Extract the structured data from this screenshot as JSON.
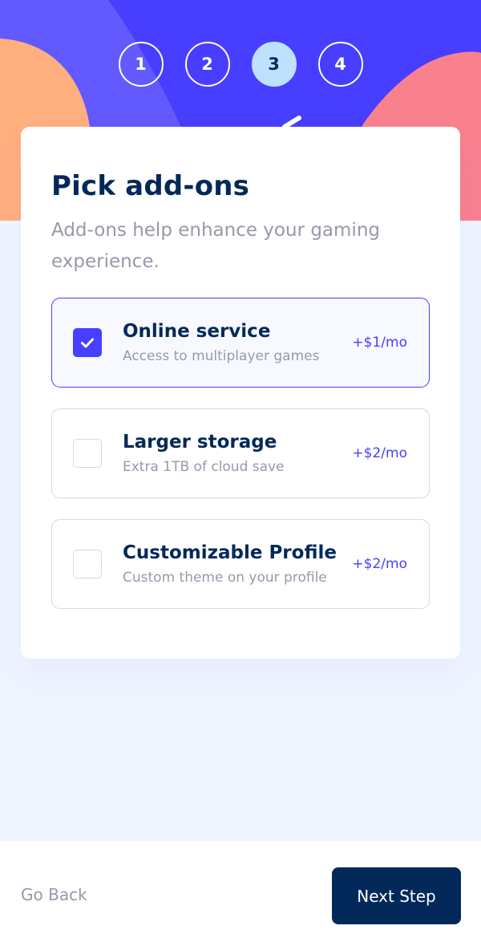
{
  "steps": [
    {
      "number": "1",
      "active": false
    },
    {
      "number": "2",
      "active": false
    },
    {
      "number": "3",
      "active": true
    },
    {
      "number": "4",
      "active": false
    }
  ],
  "page": {
    "title": "Pick add-ons",
    "subtitle": "Add-ons help enhance your gaming experience."
  },
  "addons": [
    {
      "name": "Online service",
      "description": "Access to multiplayer games",
      "price": "+$1/mo",
      "selected": true
    },
    {
      "name": "Larger storage",
      "description": "Extra 1TB of cloud save",
      "price": "+$2/mo",
      "selected": false
    },
    {
      "name": "Customizable Profile",
      "description": "Custom theme on your profile",
      "price": "+$2/mo",
      "selected": false
    }
  ],
  "footer": {
    "back_label": "Go Back",
    "next_label": "Next Step"
  },
  "colors": {
    "primary": "#022959",
    "accent": "#483eff",
    "active_step": "#bee2fd",
    "muted_text": "#9699aa",
    "border": "#d6d9e6",
    "background": "#eff5ff"
  },
  "icons": {
    "checkbox_checked": "checkmark-icon"
  }
}
